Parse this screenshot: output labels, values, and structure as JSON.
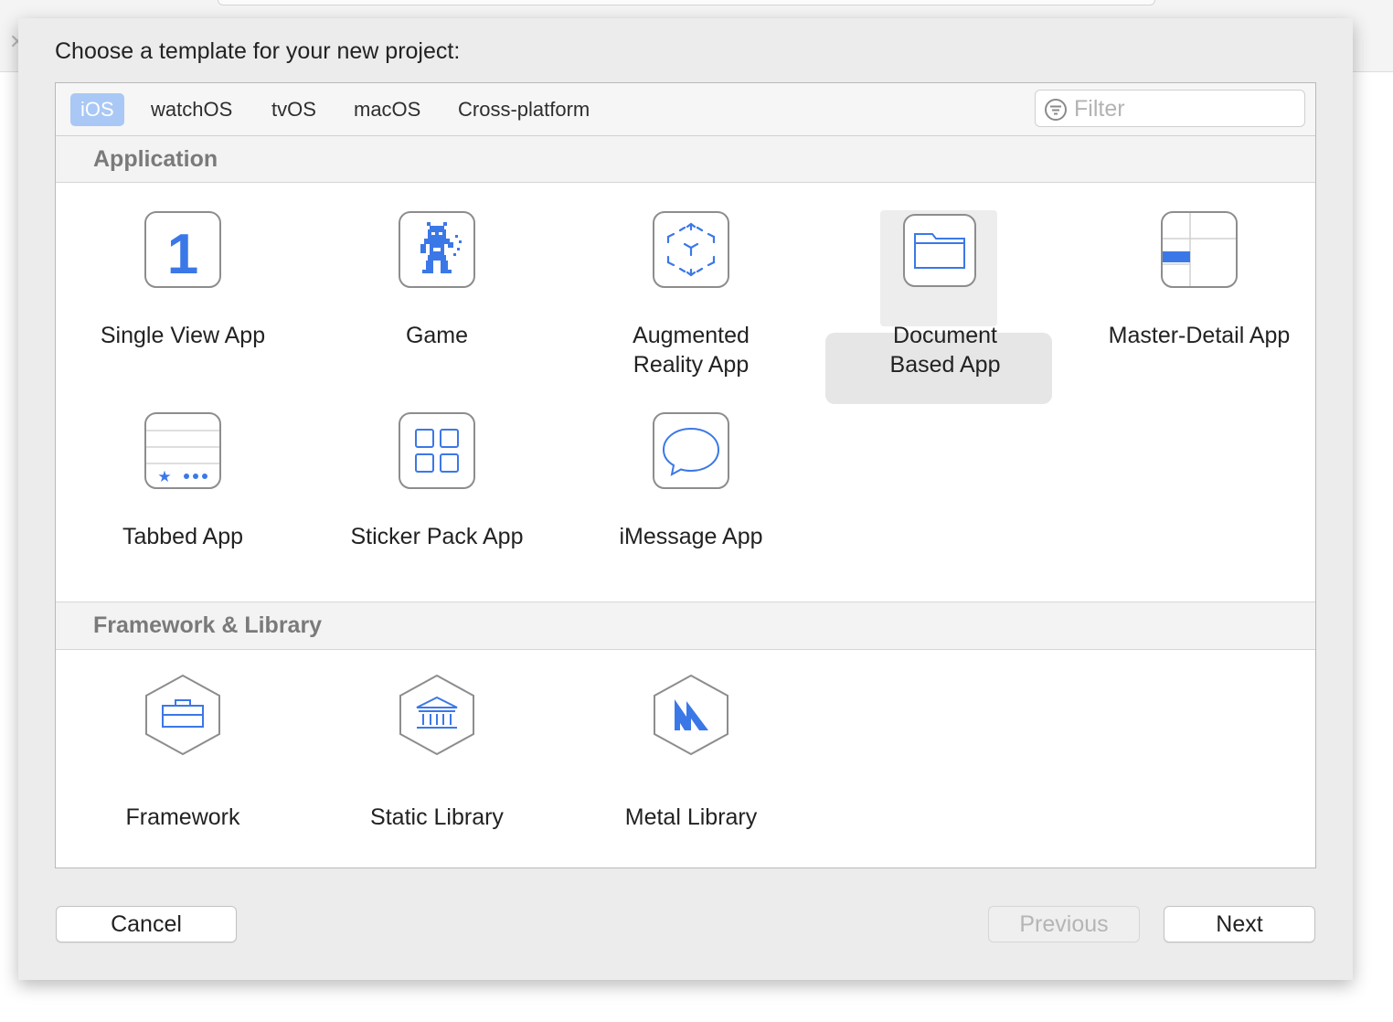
{
  "dialog": {
    "prompt": "Choose a template for your new project:"
  },
  "platform_tabs": [
    {
      "label": "iOS",
      "active": true
    },
    {
      "label": "watchOS",
      "active": false
    },
    {
      "label": "tvOS",
      "active": false
    },
    {
      "label": "macOS",
      "active": false
    },
    {
      "label": "Cross-platform",
      "active": false
    }
  ],
  "filter": {
    "placeholder": "Filter",
    "value": "",
    "icon": "filter-icon"
  },
  "sections": [
    {
      "title": "Application",
      "templates": [
        {
          "label": "Single View App",
          "icon": "single-view-app-icon",
          "selected": false
        },
        {
          "label": "Game",
          "icon": "game-icon",
          "selected": false
        },
        {
          "label": "Augmented\nReality App",
          "icon": "augmented-reality-icon",
          "selected": false
        },
        {
          "label": "Document\nBased App",
          "icon": "folder-icon",
          "selected": true
        },
        {
          "label": "Master-Detail App",
          "icon": "master-detail-icon",
          "selected": false
        },
        {
          "label": "Tabbed App",
          "icon": "tabbed-app-icon",
          "selected": false
        },
        {
          "label": "Sticker Pack App",
          "icon": "sticker-grid-icon",
          "selected": false
        },
        {
          "label": "iMessage App",
          "icon": "message-bubble-icon",
          "selected": false
        }
      ]
    },
    {
      "title": "Framework & Library",
      "templates": [
        {
          "label": "Framework",
          "icon": "toolbox-icon"
        },
        {
          "label": "Static Library",
          "icon": "library-building-icon"
        },
        {
          "label": "Metal Library",
          "icon": "metal-icon"
        }
      ]
    }
  ],
  "single_view_icon_text": "1",
  "buttons": {
    "cancel": "Cancel",
    "previous": "Previous",
    "next": "Next"
  },
  "colors": {
    "accent": "#3b78e7",
    "tab_active_bg": "#a9c8f5",
    "selection_bg": "#e6e6e6"
  }
}
